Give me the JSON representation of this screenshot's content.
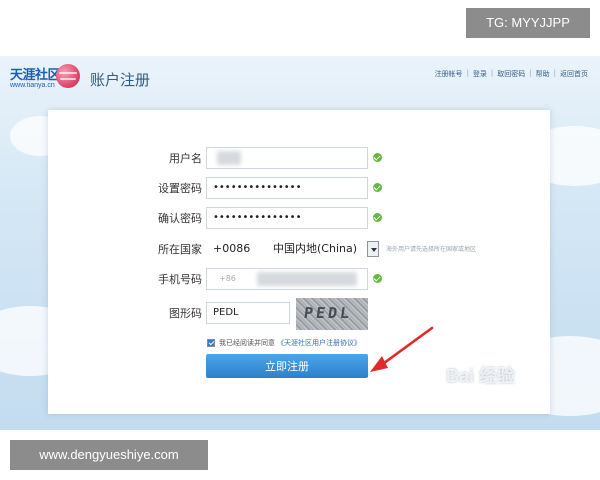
{
  "overlay": {
    "tg_label": "TG: MYYJJPP",
    "site_label": "www.dengyueshiye.com"
  },
  "header": {
    "logo_text": "天涯社区",
    "logo_url": "www.tianya.cn",
    "title": "账户注册",
    "links": [
      "注册帐号",
      "登录",
      "取回密码",
      "帮助",
      "返回首页"
    ]
  },
  "form": {
    "username": {
      "label": "用户名",
      "value": ""
    },
    "password": {
      "label": "设置密码",
      "value": "•••••••••••••••"
    },
    "confirm_password": {
      "label": "确认密码",
      "value": "•••••••••••••••"
    },
    "country": {
      "label": "所在国家",
      "code": "+0086",
      "name": "中国内地(China)",
      "hint": "海外用户请先选择所在国家或地区"
    },
    "phone": {
      "label": "手机号码",
      "prefix": "+86",
      "value": ""
    },
    "captcha": {
      "label": "图形码",
      "value": "PEDL",
      "image_text": "PEDL"
    },
    "agree": {
      "text": "我已经阅读并同意",
      "link": "《天涯社区用户注册协议》",
      "checked": true
    },
    "submit_label": "立即注册"
  },
  "watermark": "Bai 经验"
}
